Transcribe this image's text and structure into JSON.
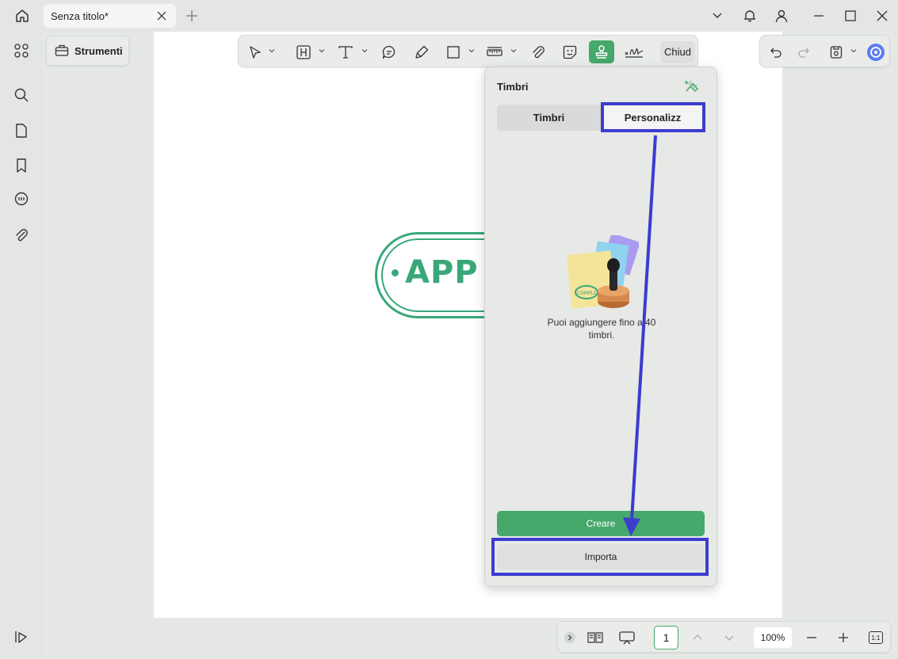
{
  "titlebar": {
    "tab_title": "Senza titolo*"
  },
  "toolbar": {
    "strumenti_label": "Strumenti",
    "close_label": "Chiud",
    "active_tool": "stamp-icon"
  },
  "document": {
    "stamp_text": "APP"
  },
  "stamp_panel": {
    "title": "Timbri",
    "tabs": [
      "Timbri",
      "Personalizz"
    ],
    "selected_tab": "Personalizz",
    "empty_message": "Puoi aggiungere fino a 40 timbri.",
    "create_label": "Creare",
    "import_label": "Importa"
  },
  "statusbar": {
    "page_number": "1",
    "zoom": "100%",
    "fit_label": "1:1"
  },
  "colors": {
    "accent": "#46a86b",
    "stamp_green": "#3aa779",
    "annotation_blue": "#3c3ccf"
  }
}
